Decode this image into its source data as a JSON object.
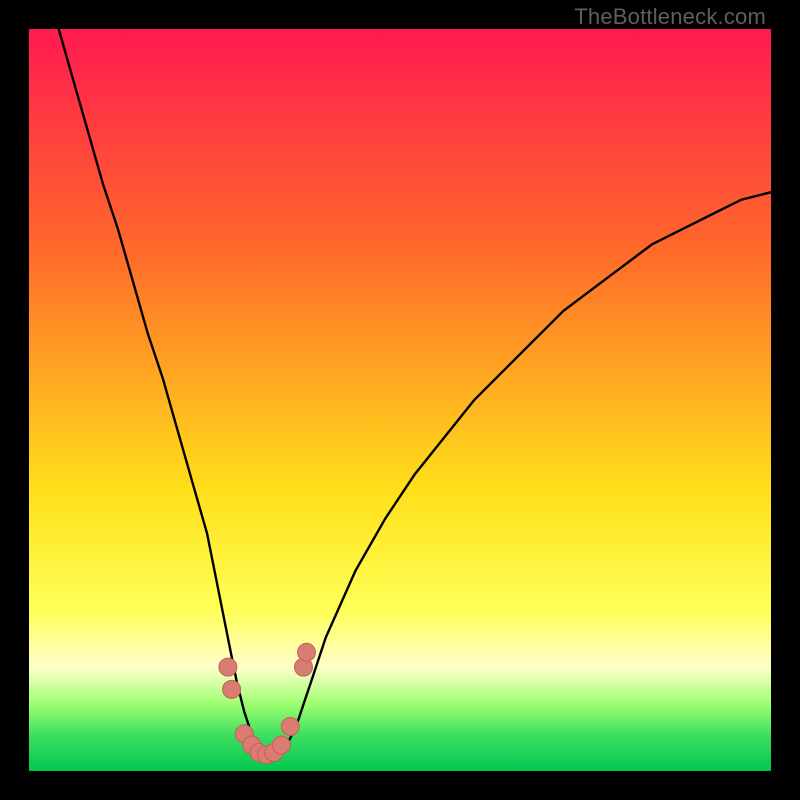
{
  "watermark": "TheBottleneck.com",
  "colors": {
    "top": "#ff1a50",
    "mid1": "#ff6a2a",
    "mid2": "#ffdf1a",
    "yellow_band": "#ffff55",
    "pale_yellow": "#ffffcc",
    "green_top": "#9dff70",
    "green_mid": "#40e060",
    "green_bot": "#00c850",
    "curve": "#000000",
    "marker_fill": "#d97c72",
    "marker_stroke": "#c46058"
  },
  "chart_data": {
    "type": "line",
    "title": "",
    "xlabel": "",
    "ylabel": "",
    "xlim": [
      0,
      100
    ],
    "ylim": [
      0,
      100
    ],
    "series": [
      {
        "name": "bottleneck-curve",
        "x": [
          4,
          6,
          8,
          10,
          12,
          14,
          16,
          18,
          20,
          22,
          24,
          25,
          26,
          27,
          28,
          29,
          30,
          31,
          32,
          33,
          34,
          35,
          36,
          37,
          38,
          40,
          44,
          48,
          52,
          56,
          60,
          64,
          68,
          72,
          76,
          80,
          84,
          88,
          92,
          96,
          100
        ],
        "y": [
          100,
          93,
          86,
          79,
          73,
          66,
          59,
          53,
          46,
          39,
          32,
          27,
          22,
          17,
          12,
          8,
          5,
          3,
          2,
          2,
          3,
          4,
          6,
          9,
          12,
          18,
          27,
          34,
          40,
          45,
          50,
          54,
          58,
          62,
          65,
          68,
          71,
          73,
          75,
          77,
          78
        ]
      }
    ],
    "markers": [
      {
        "x": 26.8,
        "y": 14
      },
      {
        "x": 27.3,
        "y": 11
      },
      {
        "x": 29.0,
        "y": 5
      },
      {
        "x": 30.0,
        "y": 3.5
      },
      {
        "x": 31.0,
        "y": 2.5
      },
      {
        "x": 32.0,
        "y": 2.2
      },
      {
        "x": 33.0,
        "y": 2.5
      },
      {
        "x": 34.0,
        "y": 3.5
      },
      {
        "x": 35.2,
        "y": 6
      },
      {
        "x": 37.0,
        "y": 14
      },
      {
        "x": 37.4,
        "y": 16
      }
    ]
  }
}
